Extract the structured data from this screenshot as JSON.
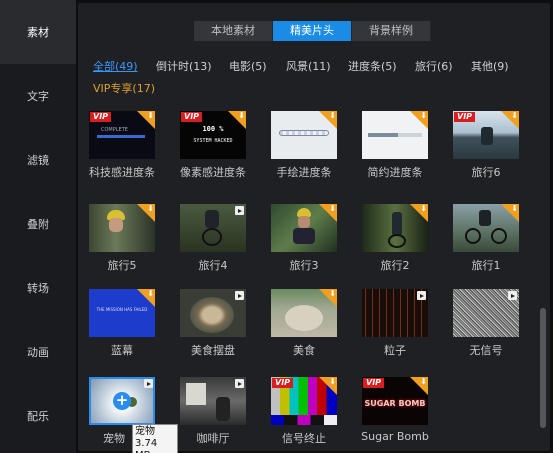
{
  "sidebar": {
    "items": [
      {
        "label": "素材",
        "active": true
      },
      {
        "label": "文字"
      },
      {
        "label": "滤镜"
      },
      {
        "label": "叠附"
      },
      {
        "label": "转场"
      },
      {
        "label": "动画"
      },
      {
        "label": "配乐"
      }
    ]
  },
  "tabs": [
    {
      "label": "本地素材"
    },
    {
      "label": "精美片头",
      "active": true
    },
    {
      "label": "背景样例"
    }
  ],
  "filters": [
    {
      "label": "全部(49)",
      "active": true
    },
    {
      "label": "倒计时(13)"
    },
    {
      "label": "电影(5)"
    },
    {
      "label": "风景(11)"
    },
    {
      "label": "进度条(5)"
    },
    {
      "label": "旅行(6)"
    },
    {
      "label": "其他(9)"
    },
    {
      "label": "VIP专享(17)",
      "vip": true
    }
  ],
  "thumb_texts": {
    "system_hacked": "SYSTEM HACKED",
    "hack_num": "100 %",
    "sugar_bomb": "SUGAR BOMB",
    "vip": "VIP",
    "complete": "COMPLETE",
    "bluescreen": "THE MISSION HAS FAILED"
  },
  "items": [
    {
      "caption": "科技感进度条",
      "vip": true,
      "badge": "download"
    },
    {
      "caption": "像素感进度条",
      "vip": true,
      "badge": "download"
    },
    {
      "caption": "手绘进度条",
      "badge": "download"
    },
    {
      "caption": "简约进度条",
      "badge": "download"
    },
    {
      "caption": "旅行6",
      "vip": true,
      "badge": "download"
    },
    {
      "caption": "旅行5",
      "badge": "download"
    },
    {
      "caption": "旅行4",
      "badge": "play"
    },
    {
      "caption": "旅行3",
      "badge": "download"
    },
    {
      "caption": "旅行2",
      "badge": "download"
    },
    {
      "caption": "旅行1",
      "badge": "download"
    },
    {
      "caption": "蓝幕",
      "badge": "download"
    },
    {
      "caption": "美食摆盘",
      "badge": "play"
    },
    {
      "caption": "美食",
      "badge": "download"
    },
    {
      "caption": "粒子",
      "badge": "play"
    },
    {
      "caption": "无信号",
      "badge": "play"
    },
    {
      "caption": "宠物",
      "badge": "play",
      "selected": true
    },
    {
      "caption": "咖啡厅",
      "badge": "play"
    },
    {
      "caption": "信号终止",
      "vip": true,
      "badge": "download"
    },
    {
      "caption": "Sugar Bomb",
      "vip": true,
      "badge": "download"
    }
  ],
  "tooltip": {
    "name": "宠物",
    "size": "3.74 MB"
  },
  "colors": {
    "accent": "#1a8ce6",
    "vip": "#e0a030",
    "vip_tag": "#d81e1e",
    "download_badge": "#f0a020"
  }
}
